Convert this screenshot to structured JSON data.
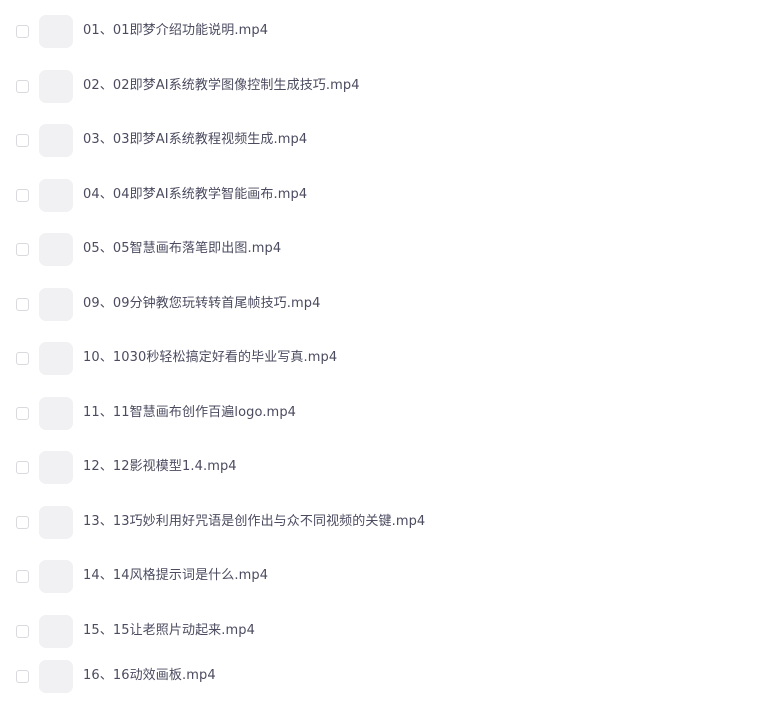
{
  "file_list": {
    "items": [
      {
        "name": "01、01即梦介绍功能说明.mp4",
        "checked": false
      },
      {
        "name": "02、02即梦AI系统教学图像控制生成技巧.mp4",
        "checked": false
      },
      {
        "name": "03、03即梦AI系统教程视频生成.mp4",
        "checked": false
      },
      {
        "name": "04、04即梦AI系统教学智能画布.mp4",
        "checked": false
      },
      {
        "name": "05、05智慧画布落笔即出图.mp4",
        "checked": false
      },
      {
        "name": "09、09分钟教您玩转转首尾帧技巧.mp4",
        "checked": false
      },
      {
        "name": "10、1030秒轻松搞定好看的毕业写真.mp4",
        "checked": false
      },
      {
        "name": "11、11智慧画布创作百遍logo.mp4",
        "checked": false
      },
      {
        "name": "12、12影视模型1.4.mp4",
        "checked": false
      },
      {
        "name": "13、13巧妙利用好咒语是创作出与众不同视频的关键.mp4",
        "checked": false
      },
      {
        "name": "14、14风格提示词是什么.mp4",
        "checked": false
      },
      {
        "name": "15、15让老照片动起来.mp4",
        "checked": false
      },
      {
        "name": "16、16动效画板.mp4",
        "checked": false
      }
    ]
  }
}
